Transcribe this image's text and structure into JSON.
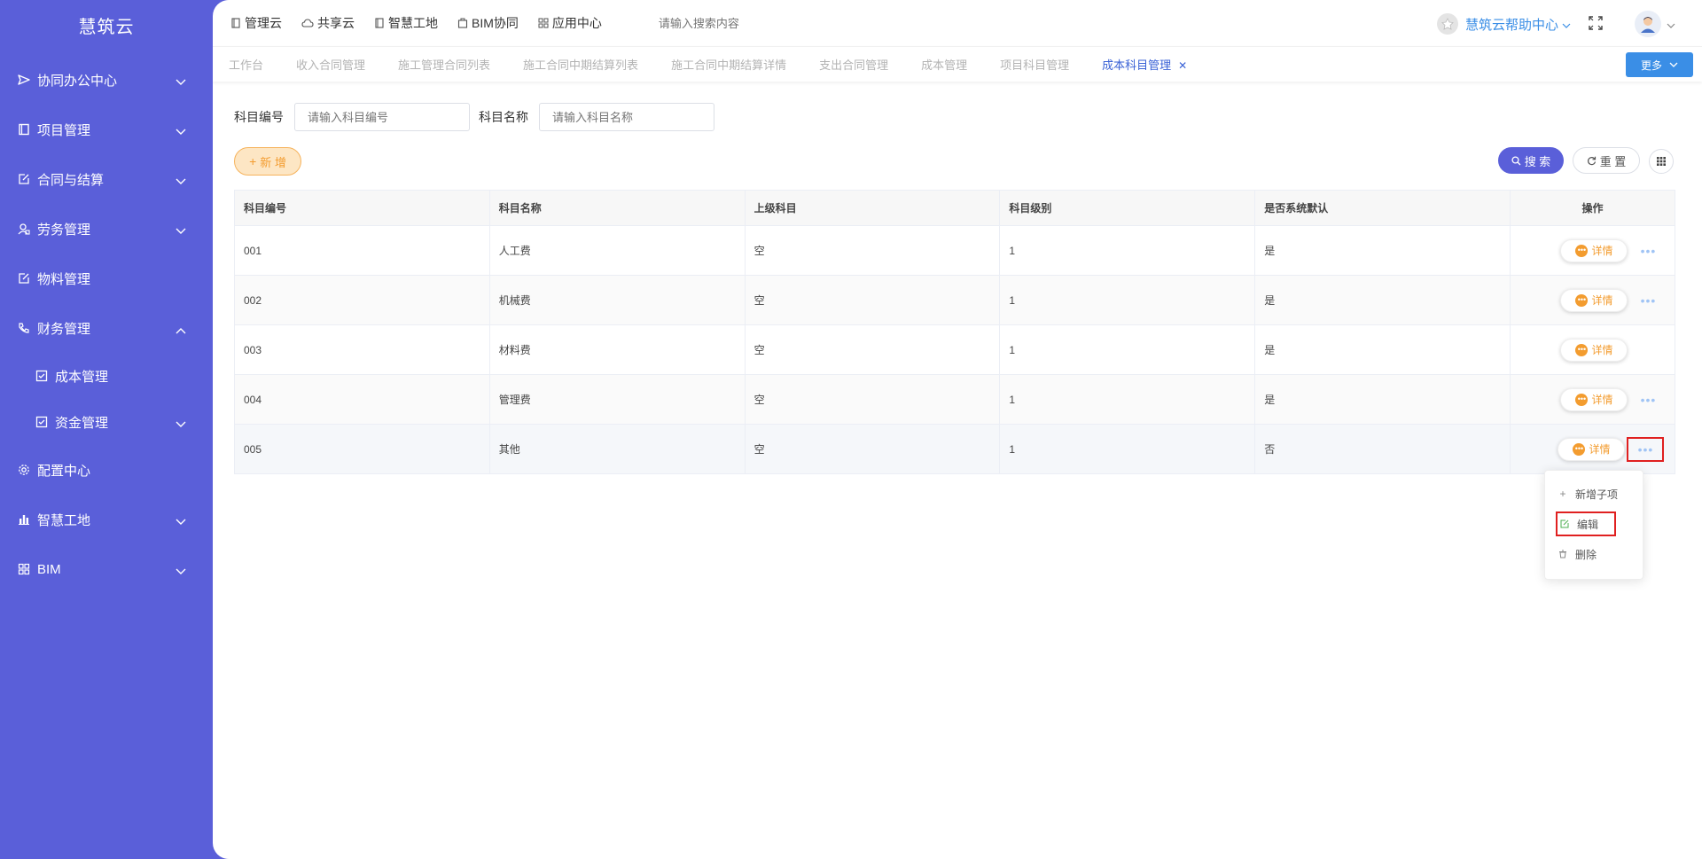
{
  "brand": "慧筑云",
  "sidebar": {
    "items": [
      {
        "label": "协同办公中心",
        "icon": "send-icon"
      },
      {
        "label": "项目管理",
        "icon": "book-icon"
      },
      {
        "label": "合同与结算",
        "icon": "edit-icon"
      },
      {
        "label": "劳务管理",
        "icon": "user-badge-icon"
      },
      {
        "label": "物料管理",
        "icon": "edit-icon"
      },
      {
        "label": "财务管理",
        "icon": "phone-icon"
      },
      {
        "label": "成本管理",
        "icon": "checkbox-icon"
      },
      {
        "label": "资金管理",
        "icon": "checkbox-icon"
      },
      {
        "label": "配置中心",
        "icon": "gear-icon"
      },
      {
        "label": "智慧工地",
        "icon": "bar-chart-icon"
      },
      {
        "label": "BIM",
        "icon": "grid-icon"
      }
    ]
  },
  "topbar": {
    "links": [
      "管理云",
      "共享云",
      "智慧工地",
      "BIM协同",
      "应用中心"
    ],
    "search_placeholder": "请输入搜索内容",
    "help_label": "慧筑云帮助中心"
  },
  "tabs": {
    "items": [
      "工作台",
      "收入合同管理",
      "施工管理合同列表",
      "施工合同中期结算列表",
      "施工合同中期结算详情",
      "支出合同管理",
      "成本管理",
      "项目科目管理",
      "成本科目管理"
    ],
    "active_index": 8,
    "more_label": "更多"
  },
  "filters": {
    "code_label": "科目编号",
    "code_placeholder": "请输入科目编号",
    "name_label": "科目名称",
    "name_placeholder": "请输入科目名称"
  },
  "buttons": {
    "add": "新 增",
    "search": "搜 索",
    "reset": "重 置"
  },
  "table": {
    "headers": [
      "科目编号",
      "科目名称",
      "上级科目",
      "科目级别",
      "是否系统默认",
      "操作"
    ],
    "rows": [
      {
        "code": "001",
        "name": "人工费",
        "parent": "空",
        "level": "1",
        "default": "是",
        "has_more": true
      },
      {
        "code": "002",
        "name": "机械费",
        "parent": "空",
        "level": "1",
        "default": "是",
        "has_more": true
      },
      {
        "code": "003",
        "name": "材料费",
        "parent": "空",
        "level": "1",
        "default": "是",
        "has_more": false
      },
      {
        "code": "004",
        "name": "管理费",
        "parent": "空",
        "level": "1",
        "default": "是",
        "has_more": true
      },
      {
        "code": "005",
        "name": "其他",
        "parent": "空",
        "level": "1",
        "default": "否",
        "has_more": true
      }
    ],
    "detail_label": "详情"
  },
  "dropdown": {
    "items": [
      "新增子项",
      "编辑",
      "删除"
    ]
  },
  "colors": {
    "sidebar": "#5a5fd9",
    "accent_blue": "#3a8ee6",
    "orange": "#f39c2f",
    "highlight_red": "#e02020"
  }
}
